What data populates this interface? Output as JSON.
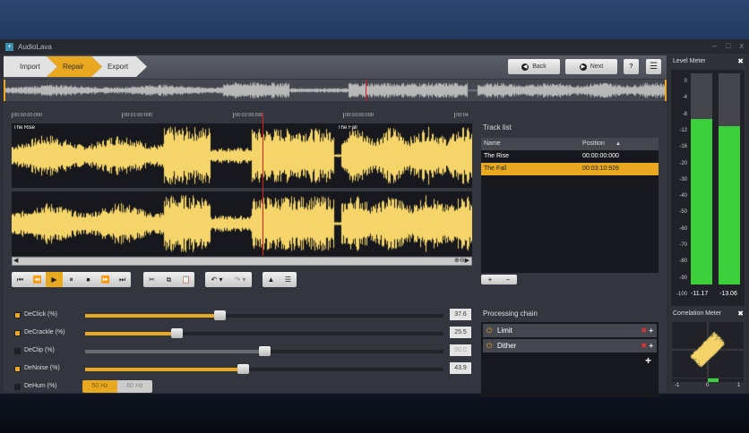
{
  "app": {
    "title": "AudioLava"
  },
  "window_controls": {
    "minimize": "–",
    "maximize": "□",
    "close": "x"
  },
  "steps": [
    {
      "label": "Import"
    },
    {
      "label": "Repair"
    },
    {
      "label": "Export"
    }
  ],
  "nav": {
    "back": "Back",
    "next": "Next",
    "help": "?",
    "menu": "☰"
  },
  "timeline": {
    "ticks": [
      "00:00:00:000",
      "00:01:00:000",
      "00:02:00:000",
      "00:03:00:000",
      "00:04"
    ],
    "tracks": [
      "The Rise",
      "The Fall"
    ]
  },
  "transport": {
    "buttons": [
      "⏮",
      "⏪",
      "▶",
      "⏸",
      "⏹",
      "⏩",
      "⏭"
    ],
    "edit": [
      "✂",
      "⧉",
      "📋"
    ],
    "undo": "↶ ▾",
    "redo": "↷ ▾",
    "view": [
      "▲",
      "☰"
    ]
  },
  "effects": [
    {
      "label": "DeClick (%)",
      "enabled": true,
      "value": "37.6",
      "percent": 37.6
    },
    {
      "label": "DeCrackle (%)",
      "enabled": true,
      "value": "25.5",
      "percent": 25.5
    },
    {
      "label": "DeClip (%)",
      "enabled": false,
      "value": "50.0",
      "percent": 50
    },
    {
      "label": "DeNoise (%)",
      "enabled": true,
      "value": "43.9",
      "percent": 43.9
    },
    {
      "label": "DeHum (%)",
      "enabled": false,
      "options": [
        "50 Hz",
        "60 Hz"
      ],
      "selected": "50 Hz"
    }
  ],
  "track_list": {
    "title": "Track list",
    "columns": [
      "Name",
      "Position"
    ],
    "sort_icon": "▲",
    "rows": [
      {
        "name": "The Rise",
        "position": "00:00:00:000"
      },
      {
        "name": "The Fall",
        "position": "00:03:10:926"
      }
    ],
    "add": "+",
    "remove": "−"
  },
  "processing_chain": {
    "title": "Processing chain",
    "items": [
      "Limit",
      "Dither"
    ],
    "add": "+"
  },
  "level_meter": {
    "title": "Level Meter",
    "close": "✖",
    "scale": [
      "0",
      "-4",
      "-8",
      "-12",
      "-16",
      "-20",
      "-30",
      "-40",
      "-50",
      "-60",
      "-70",
      "-80",
      "-90",
      "-100"
    ],
    "left": "-11.17",
    "right": "-13.06"
  },
  "correlation_meter": {
    "title": "Correlation Meter",
    "close": "✖",
    "axis": [
      "-1",
      "0",
      "1"
    ]
  },
  "colors": {
    "accent": "#e8a820",
    "wave": "#f5d56a",
    "meter": "#3ccf3c"
  }
}
